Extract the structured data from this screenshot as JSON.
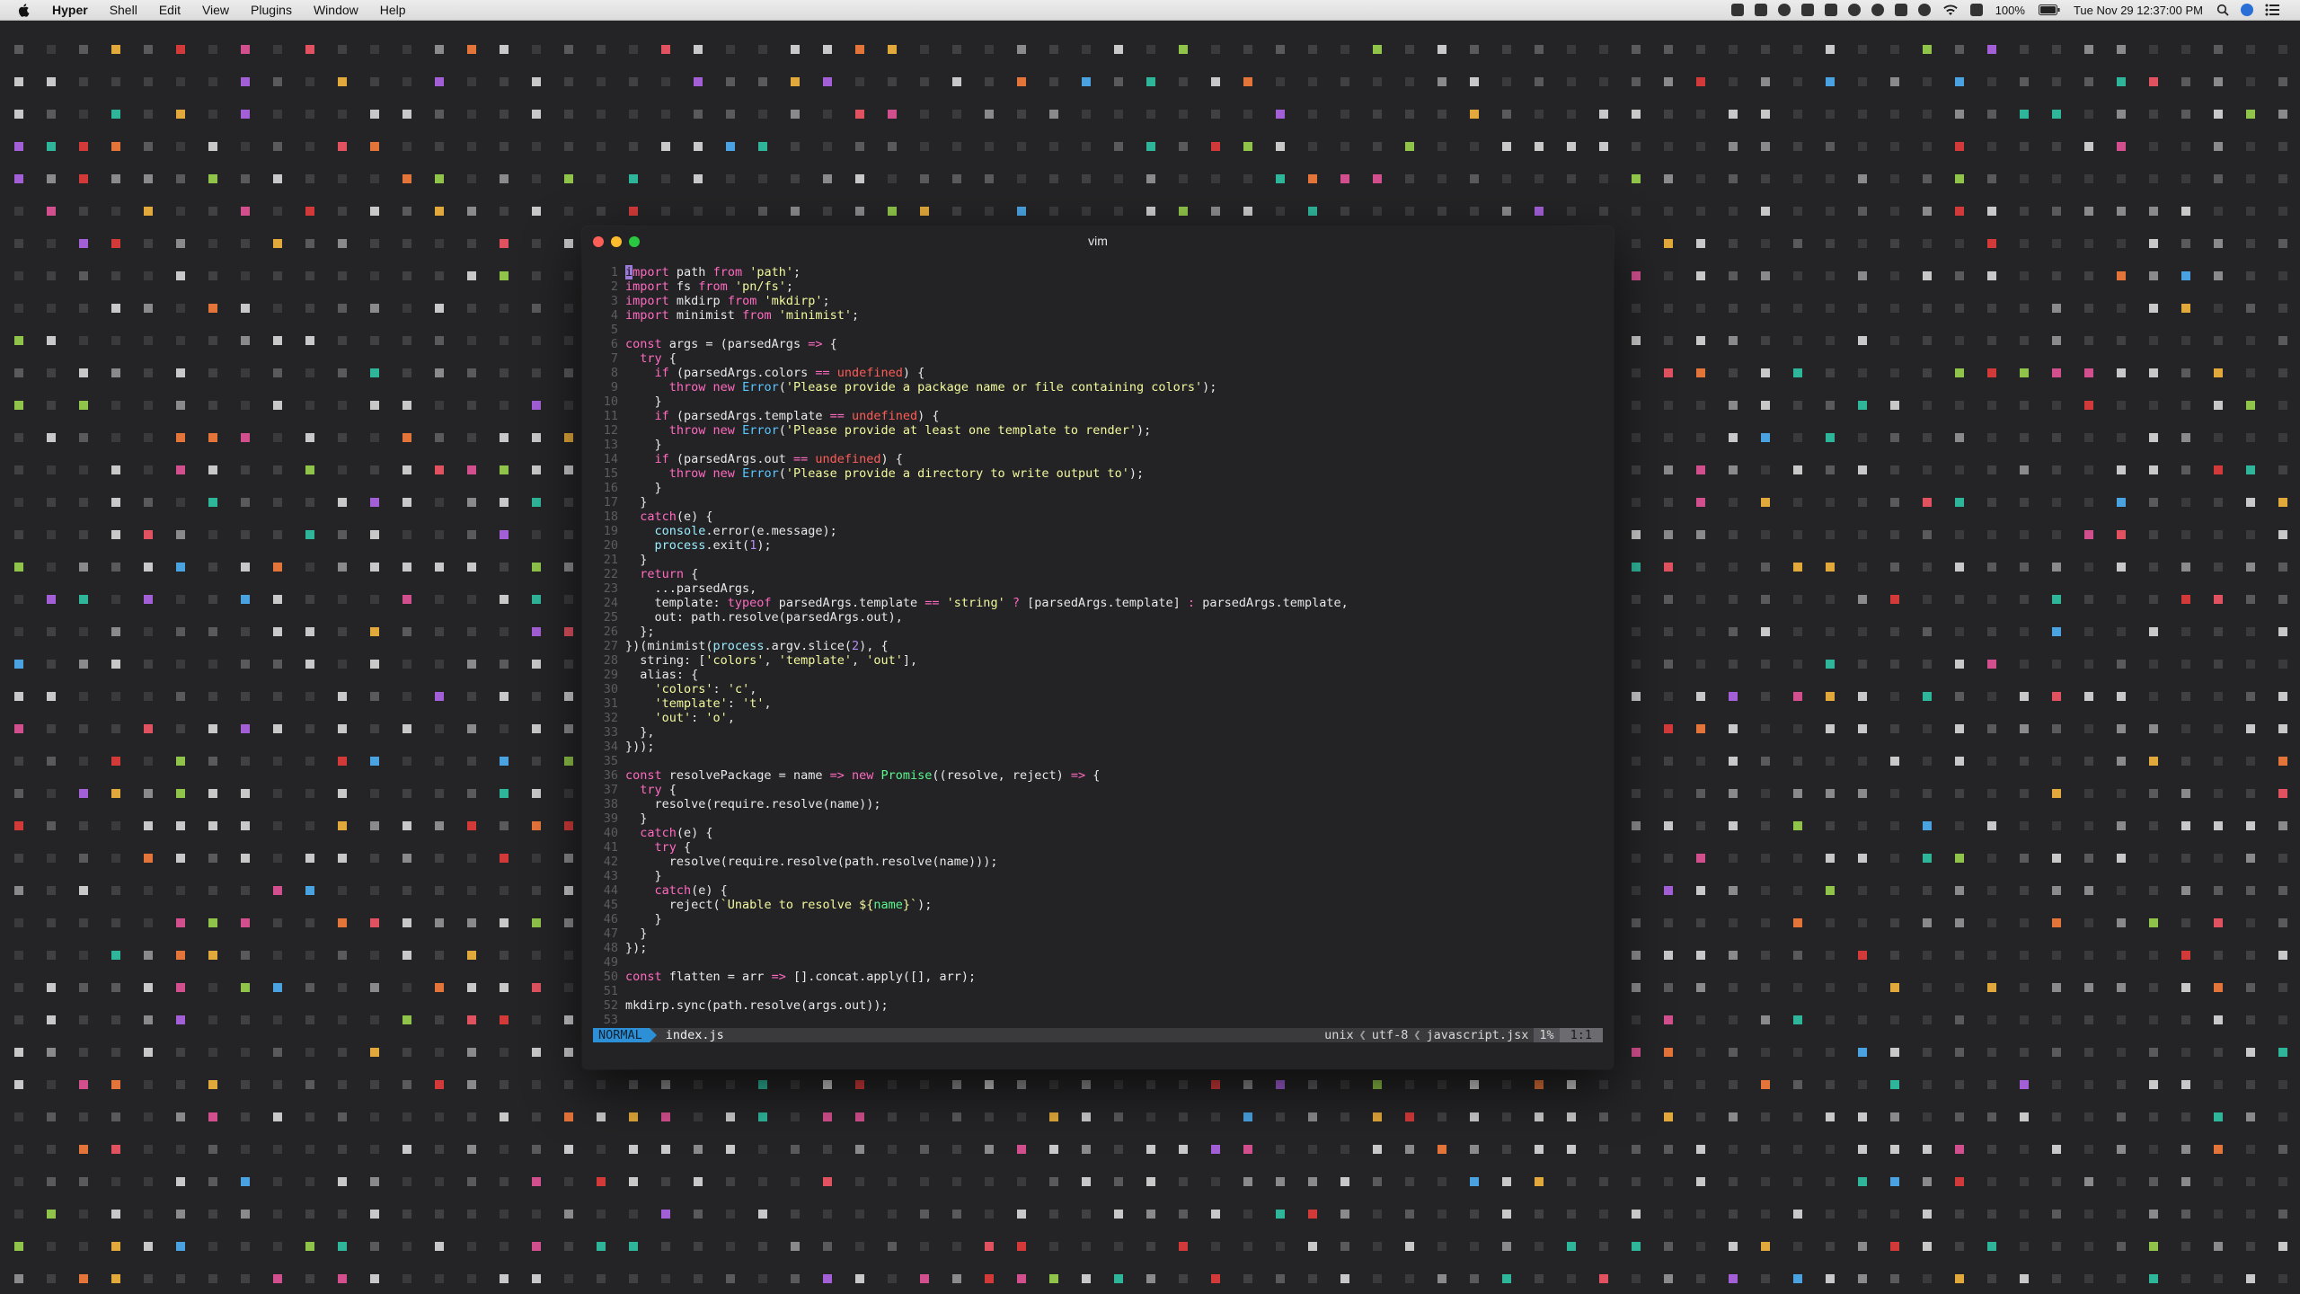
{
  "menubar": {
    "app_name": "Hyper",
    "items": [
      "Shell",
      "Edit",
      "View",
      "Plugins",
      "Window",
      "Help"
    ],
    "battery": "100%",
    "clock": "Tue Nov 29  12:37:00 PM"
  },
  "window": {
    "title": "vim"
  },
  "editor": {
    "lines": [
      [
        [
          "k",
          "import"
        ],
        [
          "d",
          " path "
        ],
        [
          "k",
          "from"
        ],
        [
          "d",
          " "
        ],
        [
          "s",
          "'path'"
        ],
        [
          "d",
          ";"
        ]
      ],
      [
        [
          "k",
          "import"
        ],
        [
          "d",
          " fs "
        ],
        [
          "k",
          "from"
        ],
        [
          "d",
          " "
        ],
        [
          "s",
          "'pn/fs'"
        ],
        [
          "d",
          ";"
        ]
      ],
      [
        [
          "k",
          "import"
        ],
        [
          "d",
          " mkdirp "
        ],
        [
          "k",
          "from"
        ],
        [
          "d",
          " "
        ],
        [
          "s",
          "'mkdirp'"
        ],
        [
          "d",
          ";"
        ]
      ],
      [
        [
          "k",
          "import"
        ],
        [
          "d",
          " minimist "
        ],
        [
          "k",
          "from"
        ],
        [
          "d",
          " "
        ],
        [
          "s",
          "'minimist'"
        ],
        [
          "d",
          ";"
        ]
      ],
      [],
      [
        [
          "k",
          "const"
        ],
        [
          "d",
          " args = (parsedArgs "
        ],
        [
          "k",
          "=>"
        ],
        [
          "d",
          " {"
        ]
      ],
      [
        [
          "d",
          "  "
        ],
        [
          "k",
          "try"
        ],
        [
          "d",
          " {"
        ]
      ],
      [
        [
          "d",
          "    "
        ],
        [
          "k",
          "if"
        ],
        [
          "d",
          " (parsedArgs.colors "
        ],
        [
          "k",
          "=="
        ],
        [
          "d",
          " "
        ],
        [
          "u",
          "undefined"
        ],
        [
          "d",
          ") {"
        ]
      ],
      [
        [
          "d",
          "      "
        ],
        [
          "k",
          "throw new"
        ],
        [
          "d",
          " "
        ],
        [
          "b",
          "Error"
        ],
        [
          "d",
          "("
        ],
        [
          "s",
          "'Please provide a package name or file containing colors'"
        ],
        [
          "d",
          ");"
        ]
      ],
      [
        [
          "d",
          "    }"
        ]
      ],
      [
        [
          "d",
          "    "
        ],
        [
          "k",
          "if"
        ],
        [
          "d",
          " (parsedArgs.template "
        ],
        [
          "k",
          "=="
        ],
        [
          "d",
          " "
        ],
        [
          "u",
          "undefined"
        ],
        [
          "d",
          ") {"
        ]
      ],
      [
        [
          "d",
          "      "
        ],
        [
          "k",
          "throw new"
        ],
        [
          "d",
          " "
        ],
        [
          "b",
          "Error"
        ],
        [
          "d",
          "("
        ],
        [
          "s",
          "'Please provide at least one template to render'"
        ],
        [
          "d",
          ");"
        ]
      ],
      [
        [
          "d",
          "    }"
        ]
      ],
      [
        [
          "d",
          "    "
        ],
        [
          "k",
          "if"
        ],
        [
          "d",
          " (parsedArgs.out "
        ],
        [
          "k",
          "=="
        ],
        [
          "d",
          " "
        ],
        [
          "u",
          "undefined"
        ],
        [
          "d",
          ") {"
        ]
      ],
      [
        [
          "d",
          "      "
        ],
        [
          "k",
          "throw new"
        ],
        [
          "d",
          " "
        ],
        [
          "b",
          "Error"
        ],
        [
          "d",
          "("
        ],
        [
          "s",
          "'Please provide a directory to write output to'"
        ],
        [
          "d",
          ");"
        ]
      ],
      [
        [
          "d",
          "    }"
        ]
      ],
      [
        [
          "d",
          "  }"
        ]
      ],
      [
        [
          "d",
          "  "
        ],
        [
          "k",
          "catch"
        ],
        [
          "d",
          "(e) {"
        ]
      ],
      [
        [
          "d",
          "    "
        ],
        [
          "p",
          "console"
        ],
        [
          "d",
          ".error(e.message);"
        ]
      ],
      [
        [
          "d",
          "    "
        ],
        [
          "p",
          "process"
        ],
        [
          "d",
          ".exit("
        ],
        [
          "n",
          "1"
        ],
        [
          "d",
          ");"
        ]
      ],
      [
        [
          "d",
          "  }"
        ]
      ],
      [
        [
          "d",
          "  "
        ],
        [
          "k",
          "return"
        ],
        [
          "d",
          " {"
        ]
      ],
      [
        [
          "d",
          "    ...parsedArgs,"
        ]
      ],
      [
        [
          "d",
          "    template: "
        ],
        [
          "k",
          "typeof"
        ],
        [
          "d",
          " parsedArgs.template "
        ],
        [
          "k",
          "=="
        ],
        [
          "d",
          " "
        ],
        [
          "s",
          "'string'"
        ],
        [
          "d",
          " "
        ],
        [
          "k",
          "?"
        ],
        [
          "d",
          " [parsedArgs.template] "
        ],
        [
          "k",
          ":"
        ],
        [
          "d",
          " parsedArgs.template,"
        ]
      ],
      [
        [
          "d",
          "    out: path.resolve(parsedArgs.out),"
        ]
      ],
      [
        [
          "d",
          "  };"
        ]
      ],
      [
        [
          "d",
          "})(minimist("
        ],
        [
          "p",
          "process"
        ],
        [
          "d",
          ".argv.slice("
        ],
        [
          "n",
          "2"
        ],
        [
          "d",
          "), {"
        ]
      ],
      [
        [
          "d",
          "  string: ["
        ],
        [
          "s",
          "'colors'"
        ],
        [
          "d",
          ", "
        ],
        [
          "s",
          "'template'"
        ],
        [
          "d",
          ", "
        ],
        [
          "s",
          "'out'"
        ],
        [
          "d",
          "],"
        ]
      ],
      [
        [
          "d",
          "  alias: {"
        ]
      ],
      [
        [
          "d",
          "    "
        ],
        [
          "s",
          "'colors'"
        ],
        [
          "d",
          ": "
        ],
        [
          "s",
          "'c'"
        ],
        [
          "d",
          ","
        ]
      ],
      [
        [
          "d",
          "    "
        ],
        [
          "s",
          "'template'"
        ],
        [
          "d",
          ": "
        ],
        [
          "s",
          "'t'"
        ],
        [
          "d",
          ","
        ]
      ],
      [
        [
          "d",
          "    "
        ],
        [
          "s",
          "'out'"
        ],
        [
          "d",
          ": "
        ],
        [
          "s",
          "'o'"
        ],
        [
          "d",
          ","
        ]
      ],
      [
        [
          "d",
          "  },"
        ]
      ],
      [
        [
          "d",
          "}));"
        ]
      ],
      [],
      [
        [
          "k",
          "const"
        ],
        [
          "d",
          " resolvePackage = name "
        ],
        [
          "k",
          "=>"
        ],
        [
          "d",
          " "
        ],
        [
          "k",
          "new"
        ],
        [
          "d",
          " "
        ],
        [
          "o",
          "Promise"
        ],
        [
          "d",
          "((resolve, reject) "
        ],
        [
          "k",
          "=>"
        ],
        [
          "d",
          " {"
        ]
      ],
      [
        [
          "d",
          "  "
        ],
        [
          "k",
          "try"
        ],
        [
          "d",
          " {"
        ]
      ],
      [
        [
          "d",
          "    resolve(require.resolve(name));"
        ]
      ],
      [
        [
          "d",
          "  }"
        ]
      ],
      [
        [
          "d",
          "  "
        ],
        [
          "k",
          "catch"
        ],
        [
          "d",
          "(e) {"
        ]
      ],
      [
        [
          "d",
          "    "
        ],
        [
          "k",
          "try"
        ],
        [
          "d",
          " {"
        ]
      ],
      [
        [
          "d",
          "      resolve(require.resolve(path.resolve(name)));"
        ]
      ],
      [
        [
          "d",
          "    }"
        ]
      ],
      [
        [
          "d",
          "    "
        ],
        [
          "k",
          "catch"
        ],
        [
          "d",
          "(e) {"
        ]
      ],
      [
        [
          "d",
          "      reject("
        ],
        [
          "s",
          "`Unable to resolve ${"
        ],
        [
          "o",
          "name"
        ],
        [
          "s",
          "}`"
        ],
        [
          "d",
          ");"
        ]
      ],
      [
        [
          "d",
          "    }"
        ]
      ],
      [
        [
          "d",
          "  }"
        ]
      ],
      [
        [
          "d",
          "});"
        ]
      ],
      [],
      [
        [
          "k",
          "const"
        ],
        [
          "d",
          " flatten = arr "
        ],
        [
          "k",
          "=>"
        ],
        [
          "d",
          " [].concat.apply([], arr);"
        ]
      ],
      [],
      [
        [
          "d",
          "mkdirp.sync(path.resolve(args.out));"
        ]
      ],
      []
    ]
  },
  "statusline": {
    "mode": "NORMAL",
    "filename": "index.js",
    "fileformat": "unix",
    "encoding": "utf-8",
    "filetype": "javascript.jsx",
    "percent": "1%",
    "position": "1:1",
    "separator": "❮"
  },
  "dot_colors": [
    "#3a3a3c",
    "#414143",
    "#5a5a5c",
    "#8a8a8c",
    "#c8c8c8",
    "#e05260",
    "#d24f8d",
    "#a35fd6",
    "#4aa2e0",
    "#2fb59a",
    "#8fc34a",
    "#e1a83b",
    "#e3743a",
    "#d23a3a"
  ]
}
